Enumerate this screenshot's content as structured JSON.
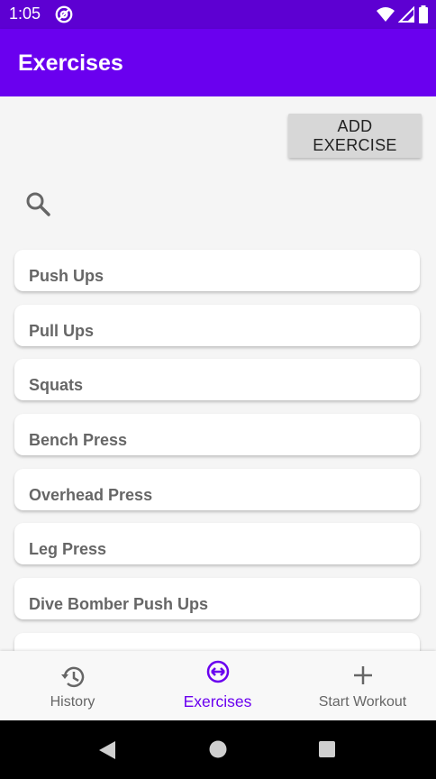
{
  "status_bar": {
    "time": "1:05",
    "icons": [
      "at-sign-icon",
      "wifi-icon",
      "signal-icon",
      "battery-icon"
    ]
  },
  "app_bar": {
    "title": "Exercises"
  },
  "toolbar": {
    "add_exercise_label": "ADD EXERCISE",
    "search_icon": "search-icon"
  },
  "exercises": [
    "Push Ups",
    "Pull Ups",
    "Squats",
    "Bench Press",
    "Overhead Press",
    "Leg Press",
    "Dive Bomber Push Ups"
  ],
  "bottom_nav": {
    "items": [
      {
        "label": "History",
        "icon": "history-icon",
        "active": false
      },
      {
        "label": "Exercises",
        "icon": "exercises-icon",
        "active": true
      },
      {
        "label": "Start Workout",
        "icon": "plus-icon",
        "active": false
      }
    ]
  },
  "system_nav": {
    "icons": [
      "back-icon",
      "home-icon",
      "recents-icon"
    ]
  },
  "colors": {
    "status_bar": "#5d00d2",
    "app_bar": "#6a00ef",
    "accent": "#6a00ef",
    "background": "#f5f5f5"
  }
}
